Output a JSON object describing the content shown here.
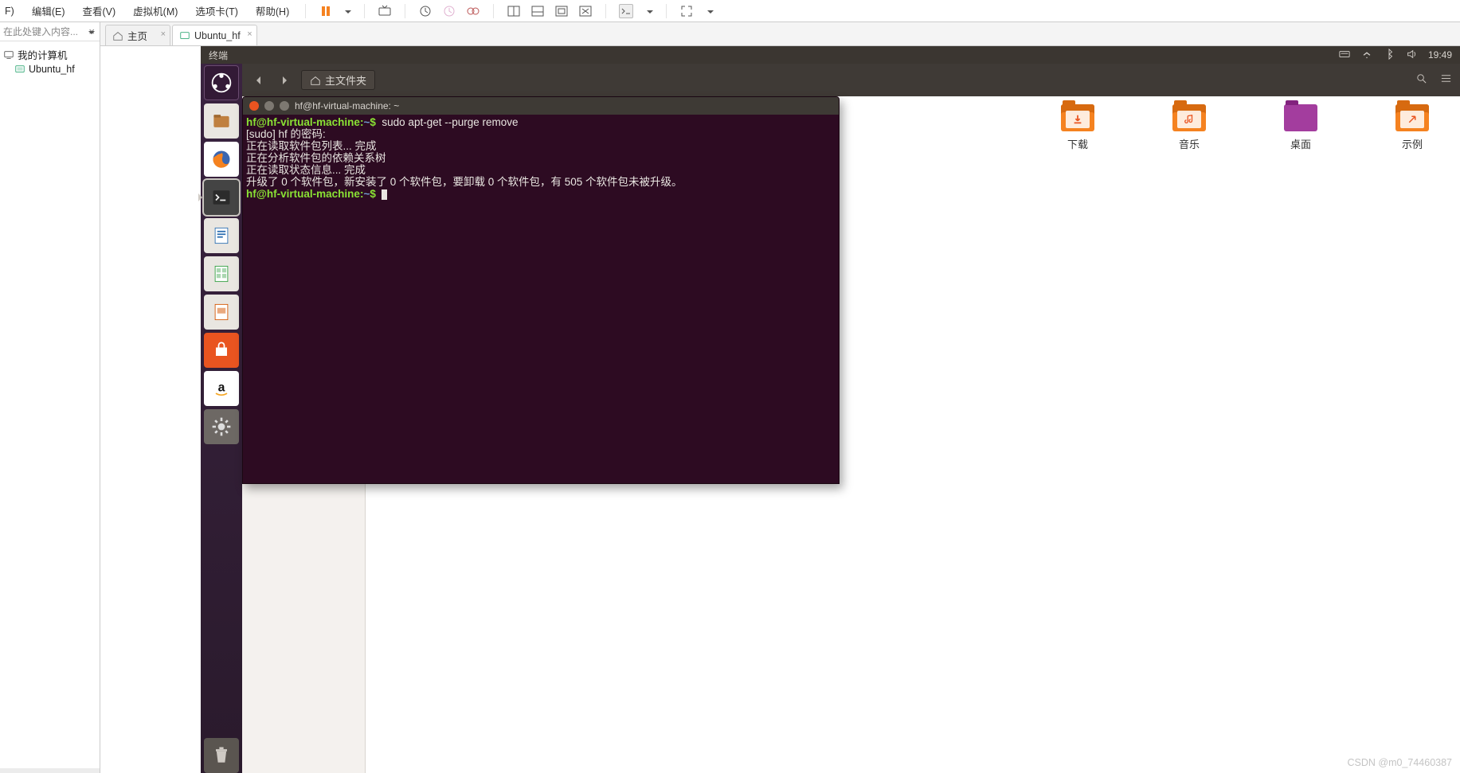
{
  "host": {
    "menus": {
      "file_suffix": "F)",
      "edit": "编辑(E)",
      "view": "查看(V)",
      "vm": "虚拟机(M)",
      "tabs": "选项卡(T)",
      "help": "帮助(H)"
    },
    "sidebar": {
      "search_placeholder": "在此处键入内容...",
      "root": "我的计算机",
      "child": "Ubuntu_hf"
    },
    "tabs": {
      "home": "主页",
      "vm": "Ubuntu_hf"
    }
  },
  "ubuntu": {
    "topbar": {
      "title": "终端",
      "clock": "19:49"
    },
    "nautilus": {
      "path_label": "主文件夹"
    },
    "desktop_icons": {
      "download": "下载",
      "music": "音乐",
      "desktop": "桌面",
      "example": "示例"
    }
  },
  "terminal": {
    "title": "hf@hf-virtual-machine: ~",
    "prompt_user": "hf@hf-virtual-machine",
    "prompt_path": "~",
    "command": "sudo apt-get --purge remove",
    "lines": {
      "l1": "[sudo] hf 的密码:",
      "l2": "正在读取软件包列表... 完成",
      "l3": "正在分析软件包的依赖关系树",
      "l4": "正在读取状态信息... 完成",
      "l5": "升级了 0 个软件包，新安装了 0 个软件包，要卸载 0 个软件包，有 505 个软件包未被升级。"
    }
  },
  "watermark": "CSDN @m0_74460387"
}
